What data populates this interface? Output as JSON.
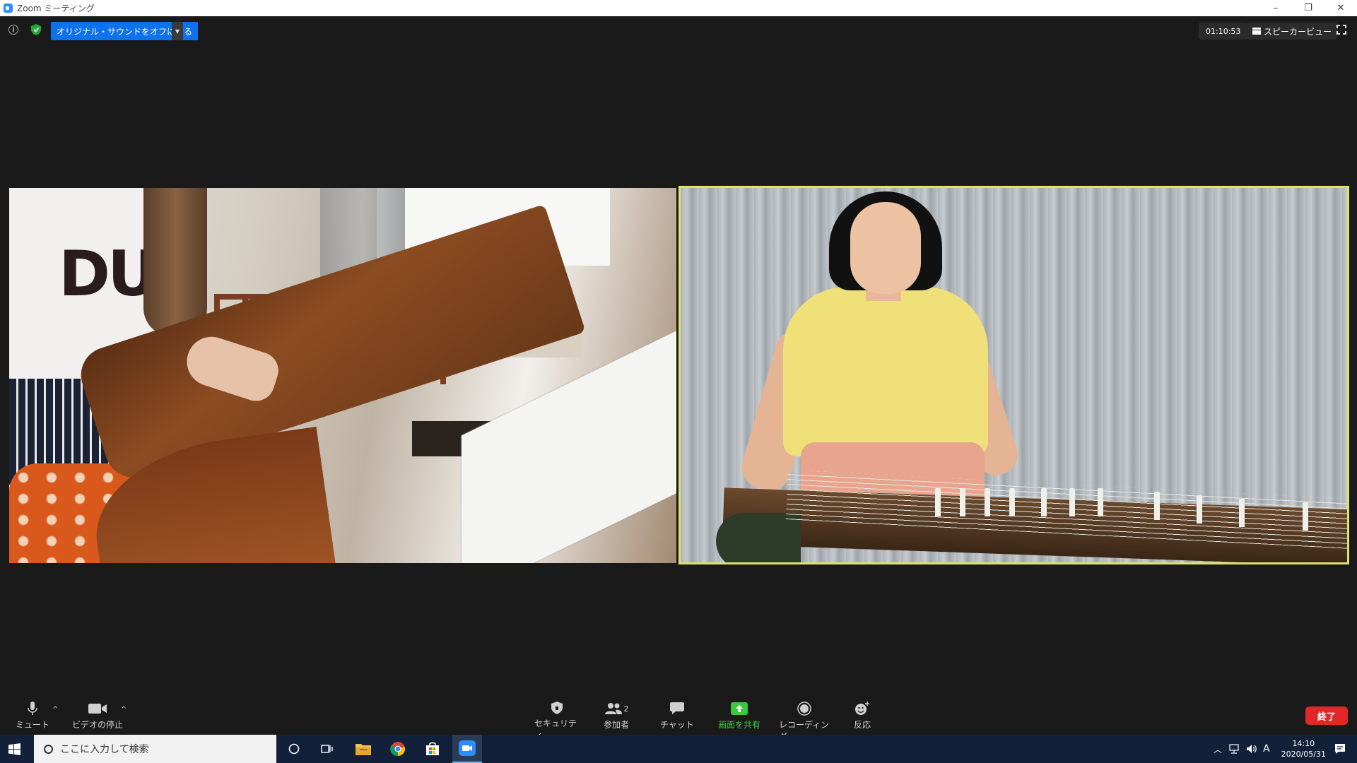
{
  "window": {
    "title": "Zoom ミーティング",
    "controls": [
      "–",
      "❐",
      "✕"
    ]
  },
  "topbar": {
    "original_sound_label": "オリジナル・サウンドをオフにする",
    "timer": "01:10:53",
    "view_label": "スピーカービュー"
  },
  "colors": {
    "accent_blue": "#0e72ed",
    "active_speaker_border": "#dfe36a",
    "share_green": "#3cc83c",
    "end_red": "#e02828",
    "taskbar_bg": "#12203a"
  },
  "toolbar": {
    "mute_label": "ミュート",
    "video_label": "ビデオの停止",
    "security_label": "セキュリティ",
    "participants_label": "参加者",
    "participants_count": "2",
    "chat_label": "チャット",
    "share_label": "画面を共有",
    "record_label": "レコーディング",
    "reaction_label": "反応",
    "end_label": "終了"
  },
  "taskbar": {
    "search_placeholder": "ここに入力して検索",
    "time": "14:10",
    "date": "2020/05/31",
    "ime": "A"
  }
}
